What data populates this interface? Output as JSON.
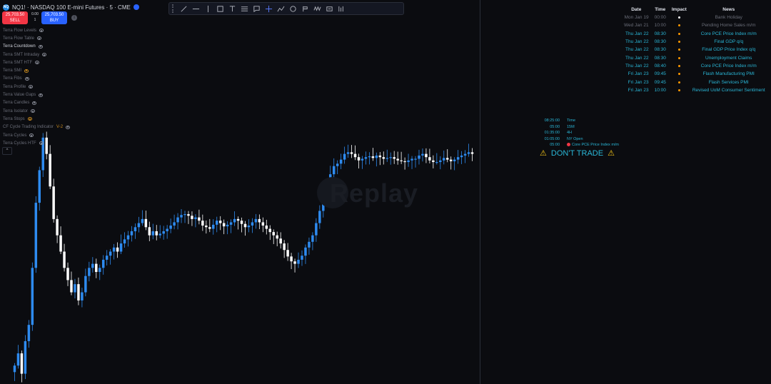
{
  "symbol": {
    "logo": "NQ",
    "title": "NQ1! · NASDAQ 100 E-mini Futures · 5 · CME",
    "badge_icon": "replay-badge-icon"
  },
  "trade": {
    "sell_price": "25,703.50",
    "sell_label": "SELL",
    "buy_price": "25,703.50",
    "buy_label": "BUY",
    "spread_top": "0.00",
    "spread_bottom": "1"
  },
  "indicators": [
    {
      "name": "Terra Flow Levels",
      "visible": true,
      "active": false
    },
    {
      "name": "Terra Flow Table",
      "visible": true,
      "active": false
    },
    {
      "name": "Terra Countdown",
      "visible": true,
      "active": true
    },
    {
      "name": "Terra SMT Intraday",
      "visible": true,
      "active": false
    },
    {
      "name": "Terra SMT HTF",
      "visible": true,
      "active": false
    },
    {
      "name": "Terra SMI",
      "visible": false,
      "active": false
    },
    {
      "name": "Terra Fibs",
      "visible": true,
      "active": false
    },
    {
      "name": "Terra Profile",
      "visible": true,
      "active": false
    },
    {
      "name": "Terra Value Gaps",
      "visible": true,
      "active": false
    },
    {
      "name": "Terra Candles",
      "visible": true,
      "active": false
    },
    {
      "name": "Terra Isolator",
      "visible": true,
      "active": false
    },
    {
      "name": "Terra Stops",
      "visible": false,
      "active": false
    },
    {
      "name": "CF Cycle Trading Indicator",
      "visible": true,
      "active": false,
      "extra": "V-2"
    },
    {
      "name": "Terra Cycles",
      "visible": true,
      "active": false
    },
    {
      "name": "Terra Cycles HTF",
      "visible": true,
      "active": false
    }
  ],
  "collapse_label": "^",
  "toolbar": [
    "trendline-icon",
    "horizontal-ray-icon",
    "vertical-line-icon",
    "rectangle-icon",
    "text-icon",
    "fib-icon",
    "callout-icon",
    "crosshair-icon",
    "path-icon",
    "circle-icon",
    "fork-icon",
    "pattern-icon",
    "range-icon",
    "ruler-icon"
  ],
  "watermark": "Replay",
  "news": {
    "headers": {
      "date": "Date",
      "time": "Time",
      "impact": "Impact",
      "news": "News"
    },
    "rows": [
      {
        "date": "Mon Jan 19",
        "time": "00:00",
        "impact_color": "#ffffff",
        "news": "Bank Holiday",
        "past": true
      },
      {
        "date": "Wed Jan 21",
        "time": "10:00",
        "impact_color": "#ff9800",
        "news": "Pending Home Sales m/m",
        "past": true
      },
      {
        "date": "Thu Jan 22",
        "time": "08:30",
        "impact_color": "#ff9800",
        "news": "Core PCE Price Index m/m",
        "past": false
      },
      {
        "date": "Thu Jan 22",
        "time": "08:30",
        "impact_color": "#ff9800",
        "news": "Final GDP q/q",
        "past": false
      },
      {
        "date": "Thu Jan 22",
        "time": "08:30",
        "impact_color": "#ff9800",
        "news": "Final GDP Price Index q/q",
        "past": false
      },
      {
        "date": "Thu Jan 22",
        "time": "08:30",
        "impact_color": "#ff9800",
        "news": "Unemployment Claims",
        "past": false
      },
      {
        "date": "Thu Jan 22",
        "time": "08:40",
        "impact_color": "#ff9800",
        "news": "Core PCE Price Index m/m",
        "past": false
      },
      {
        "date": "Fri Jan 23",
        "time": "09:45",
        "impact_color": "#ff9800",
        "news": "Flash Manufacturing PMI",
        "past": false
      },
      {
        "date": "Fri Jan 23",
        "time": "09:45",
        "impact_color": "#ff9800",
        "news": "Flash Services PMI",
        "past": false
      },
      {
        "date": "Fri Jan 23",
        "time": "10:00",
        "impact_color": "#ff9800",
        "news": "Revised UoM Consumer Sentiment",
        "past": false
      }
    ]
  },
  "countdown": [
    {
      "time": "08:25:00",
      "label": "Time"
    },
    {
      "time": "05:00",
      "label": "15M"
    },
    {
      "time": "01:35:00",
      "label": "4H"
    },
    {
      "time": "01:05:00",
      "label": "NY Open"
    },
    {
      "time": "05:00",
      "label": "Core PCE Price Index m/m",
      "dot": true
    }
  ],
  "warning": {
    "text": "DON'T TRADE",
    "icon": "warning-icon"
  },
  "colors": {
    "up": "#2e8bf0",
    "down": "#ffffff",
    "background": "#0b0c10",
    "accent": "#2ab6d6"
  },
  "price_series": [
    25380,
    25395,
    25370,
    25410,
    25430,
    25500,
    25580,
    25620,
    25660,
    25640,
    25600,
    25560,
    25540,
    25520,
    25500,
    25485,
    25470,
    25480,
    25460,
    25470,
    25490,
    25500,
    25505,
    25495,
    25500,
    25510,
    25515,
    25520,
    25525,
    25520,
    25530,
    25535,
    25540,
    25545,
    25550,
    25555,
    25560,
    25550,
    25540,
    25545,
    25540,
    25542,
    25545,
    25548,
    25552,
    25556,
    25562,
    25565,
    25566,
    25564,
    25560,
    25562,
    25558,
    25552,
    25550,
    25548,
    25553,
    25558,
    25555,
    25551,
    25553,
    25556,
    25560,
    25558,
    25554,
    25550,
    25552,
    25556,
    25560,
    25556,
    25552,
    25548,
    25544,
    25540,
    25536,
    25530,
    25522,
    25514,
    25508,
    25505,
    25510,
    25515,
    25525,
    25532,
    25540,
    25555,
    25570,
    25585,
    25600,
    25615,
    25625,
    25628,
    25633,
    25640,
    25642,
    25640,
    25636,
    25632,
    25634,
    25636,
    25637,
    25635,
    25638,
    25636,
    25634,
    25635,
    25636,
    25634,
    25632,
    25631,
    25630,
    25632,
    25634,
    25634,
    25638,
    25640,
    25636,
    25632,
    25630,
    25630,
    25632,
    25635,
    25633,
    25631,
    25633,
    25636,
    25638,
    25640,
    25642,
    25640
  ]
}
